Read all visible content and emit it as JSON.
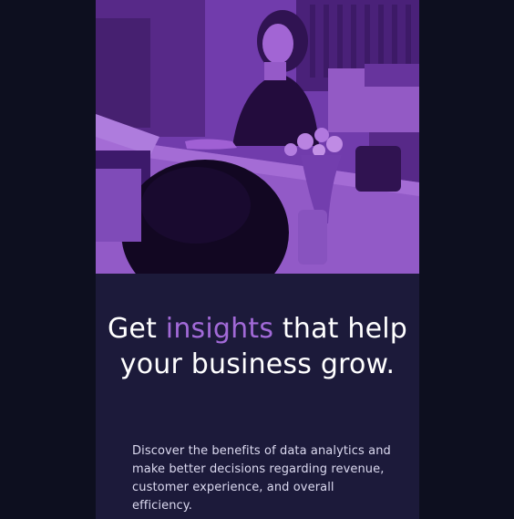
{
  "hero": {
    "image_description": "",
    "tint_color": "#a65cd9"
  },
  "headline": {
    "part1": "Get ",
    "highlight": "insights",
    "part2": " that help your business grow."
  },
  "description": "Discover the benefits of data analytics and make better decisions regarding revenue, customer experience, and overall efficiency.",
  "colors": {
    "page_background": "#0d0f1f",
    "card_background": "#1c1a3a",
    "accent": "#a26ad8",
    "headline_text": "#ffffff",
    "body_text": "#dcdaf0"
  }
}
